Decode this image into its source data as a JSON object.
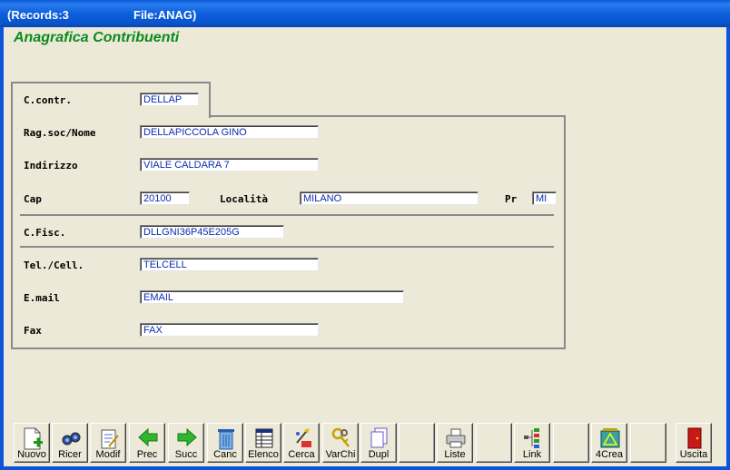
{
  "window": {
    "records": "(Records:3",
    "file": "File:ANAG)"
  },
  "form": {
    "title": "Anagrafica Contribuenti",
    "c_contr": {
      "label": "C.contr.",
      "value": "DELLAP"
    },
    "rag_soc": {
      "label": "Rag.soc/Nome",
      "value": "DELLAPICCOLA GINO"
    },
    "indirizzo": {
      "label": "Indirizzo",
      "value": "VIALE CALDARA 7"
    },
    "cap": {
      "label": "Cap",
      "value": "20100"
    },
    "localita": {
      "label": "Località",
      "value": "MILANO"
    },
    "pr": {
      "label": "Pr",
      "value": "MI"
    },
    "c_fisc": {
      "label": "C.Fisc.",
      "value": "DLLGNI36P45E205G"
    },
    "tel": {
      "label": "Tel./Cell.",
      "value": "TELCELL"
    },
    "email": {
      "label": "E.mail",
      "value": "EMAIL"
    },
    "fax": {
      "label": "Fax",
      "value": "FAX"
    }
  },
  "toolbar": {
    "nuovo": "Nuovo",
    "ricer": "Ricer",
    "modif": "Modif",
    "prec": "Prec",
    "succ": "Succ",
    "canc": "Canc",
    "elenco": "Elenco",
    "cerca": "Cerca",
    "varchi": "VarChi",
    "dupl": "Dupl",
    "liste": "Liste",
    "link": "Link",
    "crea": "4Crea",
    "uscita": "Uscita"
  }
}
